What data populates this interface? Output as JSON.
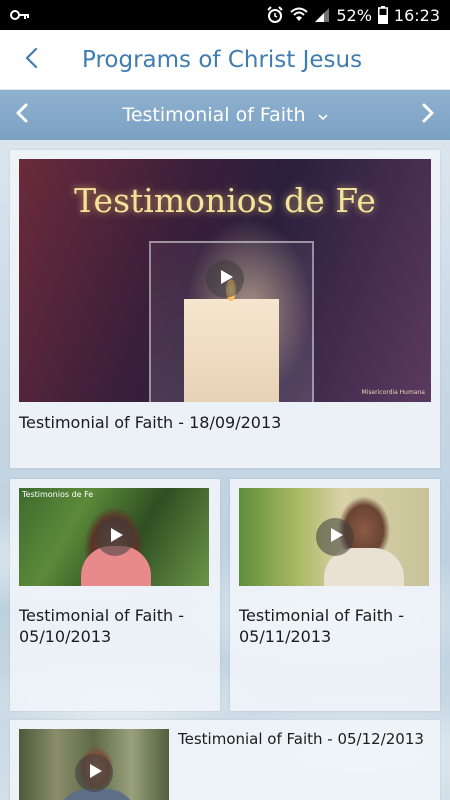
{
  "status": {
    "battery": "52%",
    "time": "16:23"
  },
  "header": {
    "title": "Programs of Christ Jesus"
  },
  "nav": {
    "category": "Testimonial of Faith"
  },
  "featured": {
    "thumb_text": "Testimonios de Fe",
    "brand": "Misericordia Humana",
    "title": "Testimonial of Faith - 18/09/2013"
  },
  "items": [
    {
      "tag": "Testimonios de Fe",
      "title_line1": "Testimonial of Faith -",
      "title_line2": "05/10/2013"
    },
    {
      "title_line1": "Testimonial of Faith -",
      "title_line2": "05/11/2013"
    },
    {
      "title": "Testimonial of Faith - 05/12/2013"
    }
  ],
  "colors": {
    "accent": "#3f7db1",
    "navbar": "#7ba1c3",
    "statusbar": "#000000"
  },
  "icons": [
    "key-icon",
    "alarm-icon",
    "wifi-icon",
    "signal-icon",
    "battery-icon",
    "back-arrow-icon",
    "chevron-left-icon",
    "chevron-down-icon",
    "chevron-right-icon",
    "play-icon"
  ]
}
